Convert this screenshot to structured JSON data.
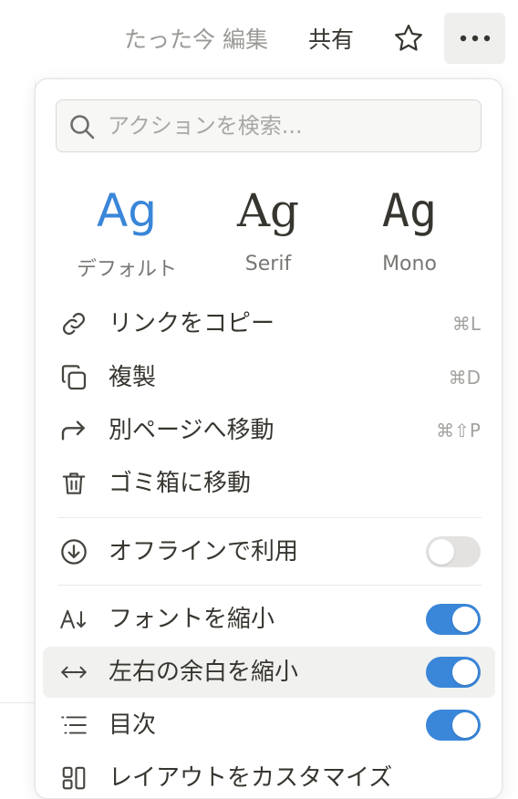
{
  "topbar": {
    "edited_text": "たった今 編集",
    "share_label": "共有",
    "icons": {
      "favorite": "star-icon",
      "more": "more-horizontal-icon"
    }
  },
  "search": {
    "placeholder": "アクションを検索...",
    "value": "",
    "icon": "search-icon"
  },
  "fonts": [
    {
      "sample": "Ag",
      "label": "デフォルト",
      "selected": true
    },
    {
      "sample": "Ag",
      "label": "Serif",
      "selected": false
    },
    {
      "sample": "Ag",
      "label": "Mono",
      "selected": false
    }
  ],
  "menu": {
    "copy_link": {
      "label": "リンクをコピー",
      "shortcut": "⌘L",
      "icon": "link-icon"
    },
    "duplicate": {
      "label": "複製",
      "shortcut": "⌘D",
      "icon": "duplicate-icon"
    },
    "move_to": {
      "label": "別ページへ移動",
      "shortcut": "⌘⇧P",
      "icon": "move-arrow-icon"
    },
    "trash": {
      "label": "ゴミ箱に移動",
      "icon": "trash-icon"
    },
    "offline": {
      "label": "オフラインで利用",
      "toggle": false,
      "icon": "download-circle-icon"
    },
    "small_text": {
      "label": "フォントを縮小",
      "toggle": true,
      "icon": "font-size-icon"
    },
    "full_width": {
      "label": "左右の余白を縮小",
      "toggle": true,
      "icon": "horizontal-arrows-icon"
    },
    "toc": {
      "label": "目次",
      "toggle": true,
      "icon": "list-icon"
    },
    "customize_layout": {
      "label": "レイアウトをカスタマイズ",
      "icon": "layout-icon"
    }
  },
  "colors": {
    "accent": "#3a86d9",
    "text": "#37352f",
    "muted": "#9b9a97",
    "toggle_off": "#e3e2e0",
    "highlight": "#f1f1ef"
  }
}
